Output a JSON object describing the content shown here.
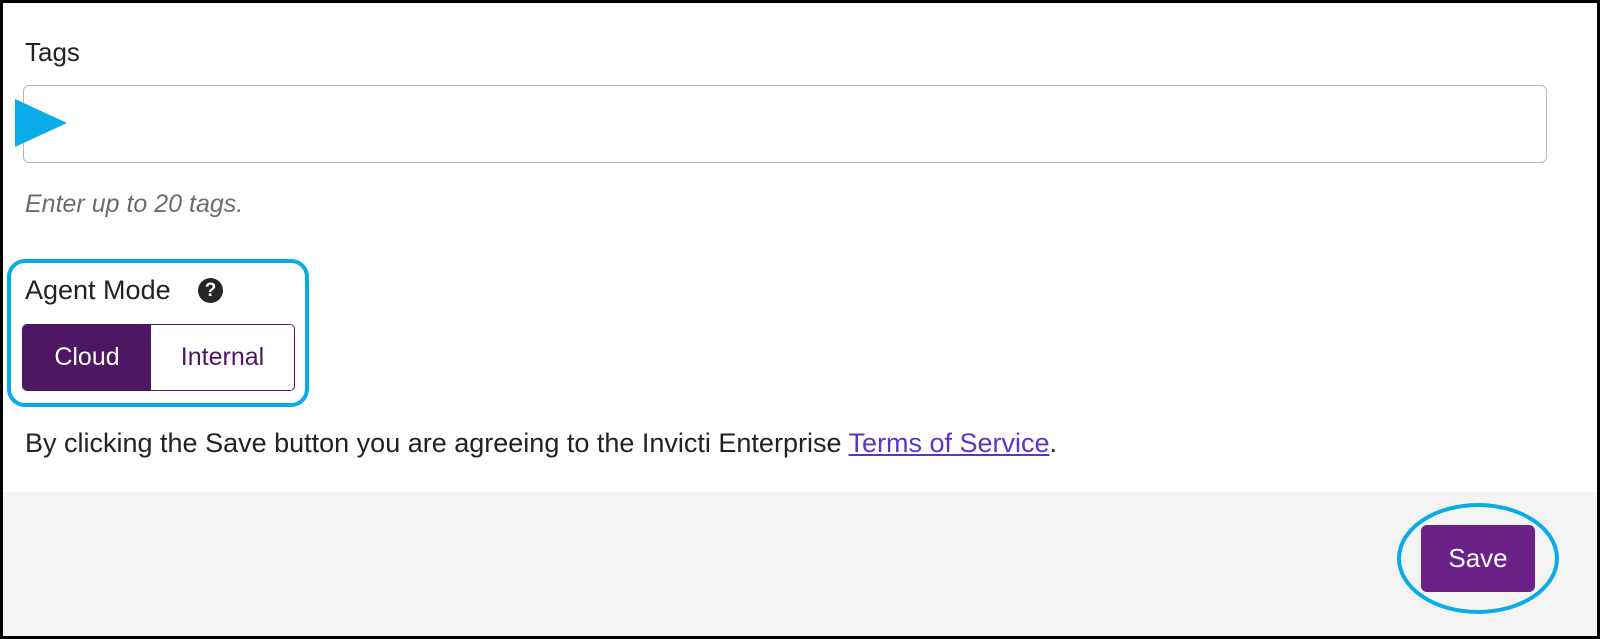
{
  "tags": {
    "label": "Tags",
    "value": "",
    "placeholder": "",
    "help": "Enter up to 20 tags."
  },
  "agent_mode": {
    "label": "Agent Mode",
    "help_icon": "question-circle-icon",
    "options": [
      "Cloud",
      "Internal"
    ],
    "selected": "Cloud"
  },
  "terms": {
    "text": "By clicking the Save button you are agreeing to the Invicti Enterprise ",
    "link": "Terms of Service",
    "suffix": "."
  },
  "footer": {
    "save_label": "Save"
  },
  "annotations": {
    "arrow_icon": "pointer-triangle-icon",
    "highlight_color": "#09ace8"
  },
  "colors": {
    "accent_purple": "#4e1763",
    "save_button": "#6c2189",
    "link": "#5b35c8"
  }
}
